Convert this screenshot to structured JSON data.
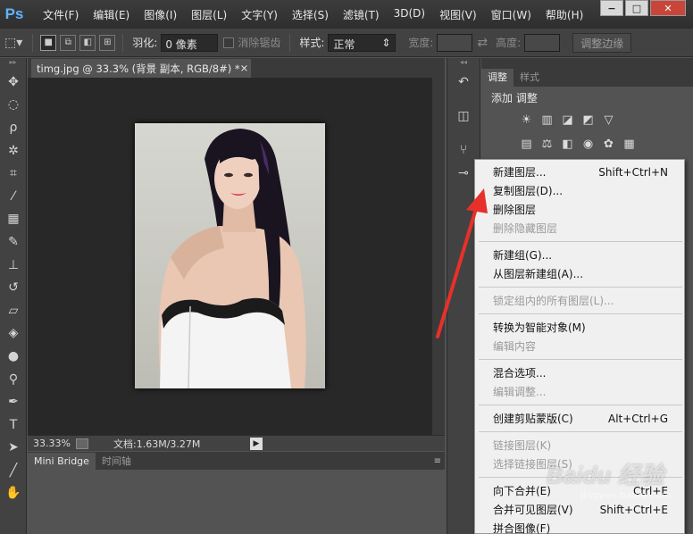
{
  "app": {
    "logo": "Ps"
  },
  "menubar": {
    "items": [
      "文件(F)",
      "编辑(E)",
      "图像(I)",
      "图层(L)",
      "文字(Y)",
      "选择(S)",
      "滤镜(T)",
      "3D(D)",
      "视图(V)",
      "窗口(W)",
      "帮助(H)"
    ],
    "window_controls": [
      "−",
      "□",
      "✕"
    ]
  },
  "options": {
    "feather_label": "羽化:",
    "feather_value": "0 像素",
    "antialias_label": "消除锯齿",
    "style_label": "样式:",
    "style_value": "正常",
    "width_label": "宽度:",
    "height_label": "高度:",
    "refine_edge_label": "调整边缘"
  },
  "document": {
    "tab_title": "timg.jpg @ 33.3% (背景 副本, RGB/8#) *",
    "tab_close": "×",
    "zoom": "33.33%",
    "doc_size": "文档:1.63M/3.27M"
  },
  "bridge_panel": {
    "tabs": [
      "Mini Bridge",
      "时间轴"
    ]
  },
  "adjustments_panel": {
    "tabs": [
      "调整",
      "样式"
    ],
    "title": "添加 调整"
  },
  "context_menu": {
    "groups": [
      [
        {
          "label": "新建图层...",
          "shortcut": "Shift+Ctrl+N",
          "enabled": true
        },
        {
          "label": "复制图层(D)...",
          "shortcut": "",
          "enabled": true
        },
        {
          "label": "删除图层",
          "shortcut": "",
          "enabled": true
        },
        {
          "label": "删除隐藏图层",
          "shortcut": "",
          "enabled": false
        }
      ],
      [
        {
          "label": "新建组(G)...",
          "shortcut": "",
          "enabled": true
        },
        {
          "label": "从图层新建组(A)...",
          "shortcut": "",
          "enabled": true
        }
      ],
      [
        {
          "label": "锁定组内的所有图层(L)...",
          "shortcut": "",
          "enabled": false
        }
      ],
      [
        {
          "label": "转换为智能对象(M)",
          "shortcut": "",
          "enabled": true
        },
        {
          "label": "编辑内容",
          "shortcut": "",
          "enabled": false
        }
      ],
      [
        {
          "label": "混合选项...",
          "shortcut": "",
          "enabled": true
        },
        {
          "label": "编辑调整...",
          "shortcut": "",
          "enabled": false
        }
      ],
      [
        {
          "label": "创建剪贴蒙版(C)",
          "shortcut": "Alt+Ctrl+G",
          "enabled": true
        }
      ],
      [
        {
          "label": "链接图层(K)",
          "shortcut": "",
          "enabled": false
        },
        {
          "label": "选择链接图层(S)",
          "shortcut": "",
          "enabled": false
        }
      ],
      [
        {
          "label": "向下合并(E)",
          "shortcut": "Ctrl+E",
          "enabled": true
        },
        {
          "label": "合并可见图层(V)",
          "shortcut": "Shift+Ctrl+E",
          "enabled": true
        },
        {
          "label": "拼合图像(F)",
          "shortcut": "",
          "enabled": true
        }
      ]
    ]
  },
  "watermark": {
    "text": "Baidu 经验",
    "sub": "jingyan.baidu.com"
  },
  "colors": {
    "accent_red": "#e8302a",
    "ps_blue": "#5fb3ff"
  }
}
